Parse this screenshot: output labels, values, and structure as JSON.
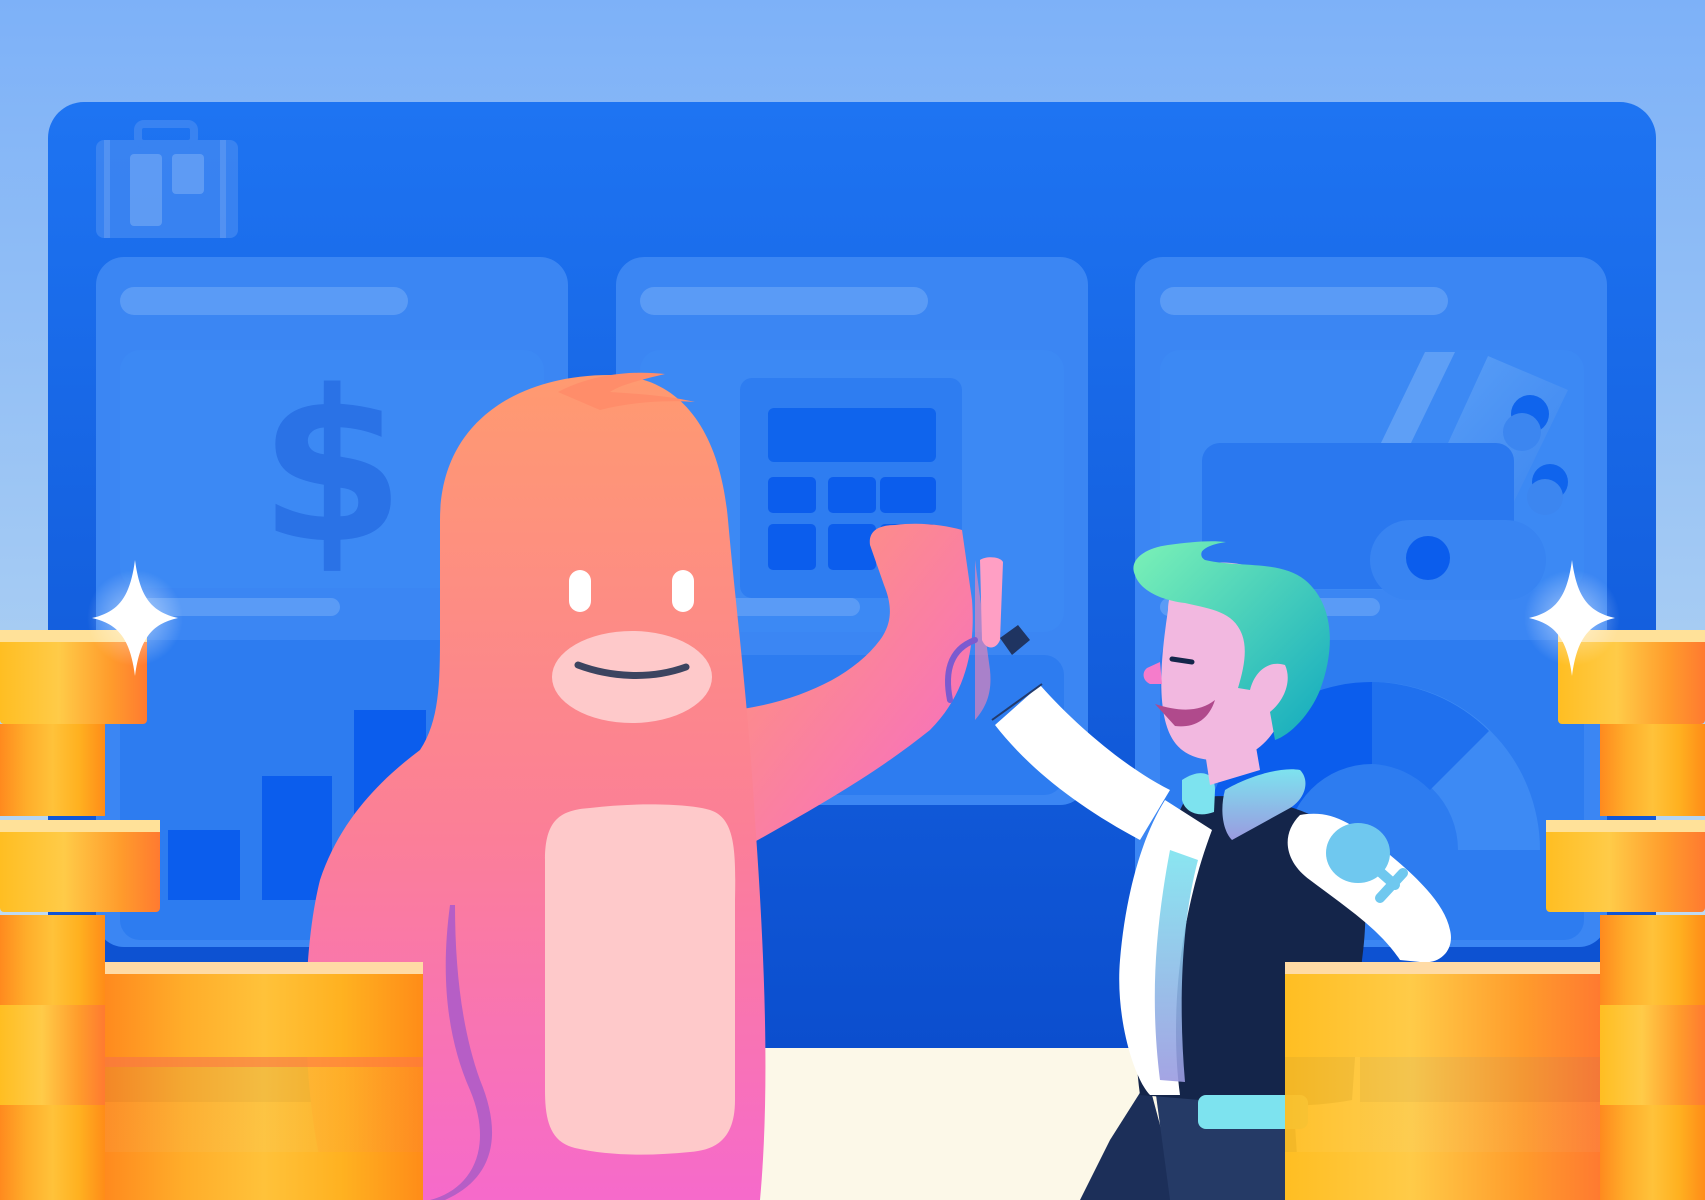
{
  "illustration": {
    "subject": "high-five",
    "icons": [
      "briefcase-icon",
      "dollar-sign-icon",
      "calculator-icon",
      "credit-card-icon",
      "wallet-icon",
      "sparkle-icon",
      "coin-stack-icon"
    ],
    "panel_glyphs": {
      "dollar": "$"
    },
    "colors": {
      "sky_top": "#7fb2f7",
      "sky_bottom": "#cfe3f3",
      "board": "#1a6ff0",
      "board_dark": "#0a4fd0",
      "panel": "#3b86f3",
      "panel_inner": "#3d8af4",
      "floor": "#fcf8e8",
      "monster_top": "#ff9770",
      "monster_bottom": "#f56ec8",
      "monster_belly": "#fec9ca",
      "person_skin": "#f2b8e0",
      "person_hair": "#2bd2b0",
      "jacket": "#14254a",
      "coin_yellow": "#ffb700",
      "coin_orange": "#ff8a1e"
    }
  }
}
